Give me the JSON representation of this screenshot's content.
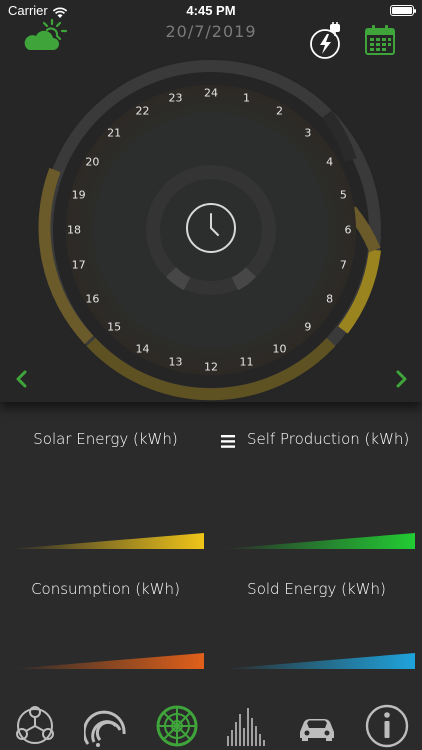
{
  "status_bar": {
    "carrier": "Carrier",
    "time": "4:45 PM"
  },
  "header": {
    "date": "20/7/2019"
  },
  "icons": {
    "weather": "cloud-sun-icon",
    "plug": "plug-power-icon",
    "calendar": "calendar-icon",
    "clock": "clock-icon",
    "prev": "chevron-left-icon",
    "next": "chevron-right-icon",
    "menu": "menu-icon"
  },
  "dial": {
    "hours": [
      "24",
      "1",
      "2",
      "3",
      "4",
      "5",
      "6",
      "7",
      "8",
      "9",
      "10",
      "11",
      "12",
      "13",
      "14",
      "15",
      "16",
      "17",
      "18",
      "19",
      "20",
      "21",
      "22",
      "23"
    ]
  },
  "cards": [
    {
      "title": "Solar Energy (kWh)",
      "color": "#f0c419"
    },
    {
      "title": "Self Production (kWh)",
      "color": "#22cc33"
    },
    {
      "title": "Consumption (kWh)",
      "color": "#e0601a"
    },
    {
      "title": "Sold Energy (kWh)",
      "color": "#1fa3dc"
    }
  ],
  "tabs": [
    {
      "name": "network-icon"
    },
    {
      "name": "gauge-icon"
    },
    {
      "name": "solar-dial-icon",
      "active": true
    },
    {
      "name": "bar-chart-icon"
    },
    {
      "name": "car-icon"
    },
    {
      "name": "info-icon"
    }
  ],
  "colors": {
    "accent": "#3fa53a",
    "background": "#2b2b2b"
  }
}
